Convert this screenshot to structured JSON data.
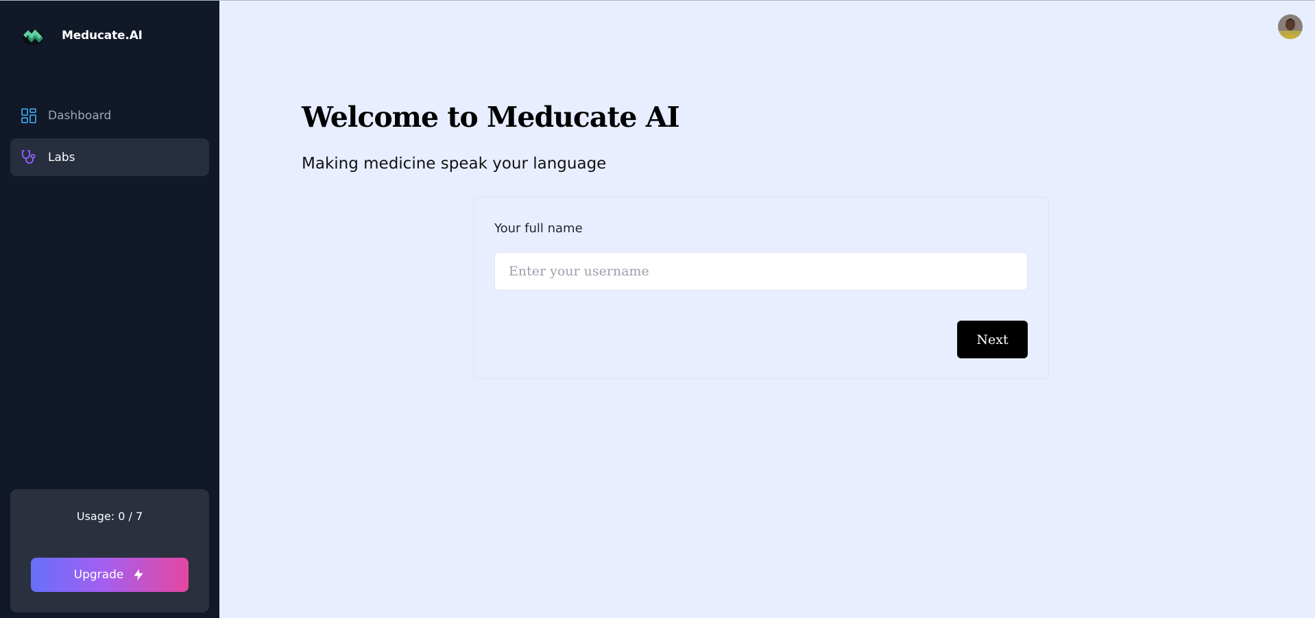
{
  "app": {
    "brand_name": "Meducate.AI",
    "logo_icon": "meducate-logo-icon"
  },
  "sidebar": {
    "items": [
      {
        "label": "Dashboard",
        "icon": "grid-icon",
        "icon_color": "#3ba0e8",
        "active": false
      },
      {
        "label": "Labs",
        "icon": "stethoscope-icon",
        "icon_color": "#8b5cf6",
        "active": true
      }
    ],
    "usage": {
      "label": "Usage: 0 / 7",
      "used": 0,
      "limit": 7
    },
    "upgrade": {
      "label": "Upgrade",
      "icon": "lightning-bolt-icon"
    }
  },
  "header": {
    "avatar_icon": "user-avatar"
  },
  "main": {
    "title": "Welcome to Meducate AI",
    "subtitle": "Making medicine speak your language",
    "form": {
      "name_label": "Your full name",
      "name_value": "",
      "name_placeholder": "Enter your username",
      "next_label": "Next"
    }
  },
  "colors": {
    "sidebar_bg": "#111827",
    "main_bg": "#e8eeff",
    "active_item_bg": "#272e3d",
    "usage_card_bg": "#2a303e",
    "upgrade_gradient_start": "#6670fb",
    "upgrade_gradient_end": "#e447a0",
    "primary_button": "#000000"
  }
}
